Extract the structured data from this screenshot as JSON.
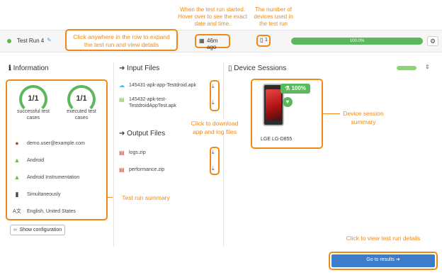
{
  "annotations": {
    "started": "When the test run started. Hover over to see the exact date and time.",
    "devices_count": "The number of devices used in the test run",
    "expand_row": "Click anywhere in the row to expand the test run and view details",
    "download": "Click to download app and log files",
    "session_summary": "Device session summary",
    "run_summary": "Test run summary",
    "view_details": "Click to view test run details"
  },
  "run": {
    "name": "Test Run 4",
    "time_ago": "46m ago",
    "devices": "1",
    "progress_label": "100.0%",
    "progress": 1.0
  },
  "information": {
    "title": "Information",
    "stats": [
      {
        "value": "1/1",
        "label": "successful test cases"
      },
      {
        "value": "1/1",
        "label": "executed test cases"
      }
    ],
    "rows": [
      {
        "icon": "user-avatar-icon",
        "text": "demo.user@example.com"
      },
      {
        "icon": "android-icon",
        "text": "Android"
      },
      {
        "icon": "android-instrumentation-icon",
        "text": "Android Instrumentation"
      },
      {
        "icon": "clipboard-icon",
        "text": "Simultaneously"
      },
      {
        "icon": "language-icon",
        "text": "English, United States"
      }
    ],
    "show_config": "Show configuration"
  },
  "input_files": {
    "title": "Input Files",
    "files": [
      {
        "icon": "cloud-icon",
        "name": "145431-apk-app-Testdroid.apk"
      },
      {
        "icon": "file-icon",
        "name": "145432-apk-test-TestdroidAppTest.apk"
      }
    ]
  },
  "output_files": {
    "title": "Output Files",
    "files": [
      {
        "icon": "file-zip-icon",
        "name": "logs.zip"
      },
      {
        "icon": "file-zip-icon",
        "name": "performance.zip"
      }
    ]
  },
  "device_sessions": {
    "title": "Device Sessions",
    "device": {
      "name": "LGE LG-D855",
      "score": "100%"
    }
  },
  "go_to_results": "Go to results ➔",
  "colors": {
    "orange": "#f08a17",
    "green": "#5cb85c",
    "blue": "#3b7dc8"
  }
}
